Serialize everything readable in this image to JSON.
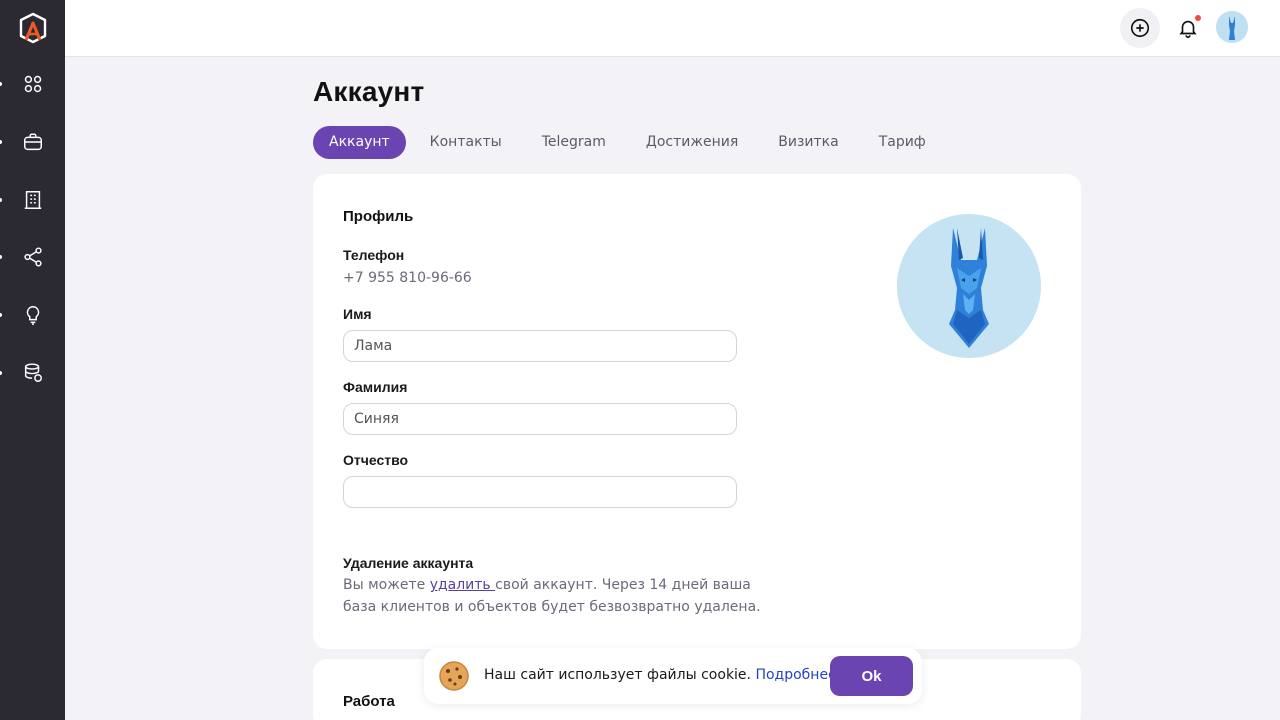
{
  "page": {
    "title": "Аккаунт"
  },
  "tabs": [
    {
      "label": "Аккаунт",
      "active": true
    },
    {
      "label": "Контакты"
    },
    {
      "label": "Telegram"
    },
    {
      "label": "Достижения"
    },
    {
      "label": "Визитка"
    },
    {
      "label": "Тариф"
    }
  ],
  "sidebar": {
    "items": [
      {
        "icon": "grid-icon"
      },
      {
        "icon": "briefcase-icon"
      },
      {
        "icon": "building-icon"
      },
      {
        "icon": "share-icon"
      },
      {
        "icon": "lightbulb-icon"
      },
      {
        "icon": "database-icon"
      }
    ]
  },
  "profile": {
    "heading": "Профиль",
    "phone_label": "Телефон",
    "phone_value": "+7 955 810-96-66",
    "first_name_label": "Имя",
    "first_name_value": "Лама",
    "last_name_label": "Фамилия",
    "last_name_value": "Синяя",
    "patronymic_label": "Отчество",
    "patronymic_value": ""
  },
  "delete_account": {
    "heading": "Удаление аккаунта",
    "text_before": "Вы можете ",
    "link": "удалить ",
    "text_after": "свой аккаунт. Через 14 дней ваша база клиентов и объектов будет безвозвратно удалена."
  },
  "work": {
    "heading": "Работа"
  },
  "cookie": {
    "text": "Наш сайт использует файлы cookie. ",
    "link": "Подробнее",
    "button": "Ok"
  },
  "colors": {
    "accent": "#6a45b2",
    "sidebar": "#2b2a33",
    "logo": "#ef5a24",
    "link": "#2442c8"
  }
}
